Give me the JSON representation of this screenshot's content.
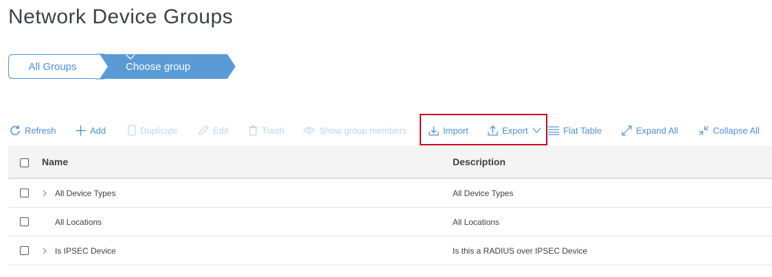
{
  "page": {
    "title": "Network Device Groups"
  },
  "breadcrumb": {
    "all_groups": "All Groups",
    "choose_group": "Choose group"
  },
  "toolbar": {
    "refresh": "Refresh",
    "add": "Add",
    "duplicate": "Duplicate",
    "edit": "Edit",
    "trash": "Trash",
    "show_members": "Show group members",
    "import": "Import",
    "export": "Export",
    "flat_table": "Flat Table",
    "expand_all": "Expand All",
    "collapse_all": "Collapse All"
  },
  "table": {
    "columns": {
      "name": "Name",
      "description": "Description"
    },
    "rows": [
      {
        "name": "All Device Types",
        "description": "All Device Types",
        "expandable": true
      },
      {
        "name": "All Locations",
        "description": "All Locations",
        "expandable": false
      },
      {
        "name": "Is IPSEC Device",
        "description": "Is this a RADIUS over IPSEC Device",
        "expandable": true
      }
    ]
  },
  "colors": {
    "accent": "#4a90d9",
    "accent_disabled": "#b9d6f0",
    "highlight": "#d0021b",
    "breadcrumb_active": "#5b9bd5"
  }
}
